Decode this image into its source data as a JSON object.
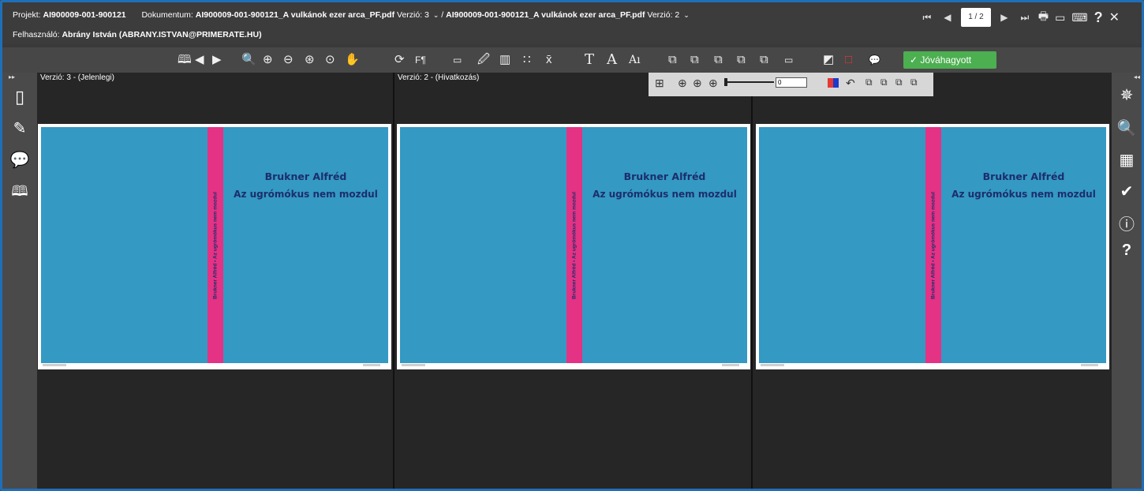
{
  "header": {
    "project_label": "Projekt:",
    "project_value": "AI900009-001-900121",
    "document_label": "Dokumentum:",
    "document_value": "AI900009-001-900121_A vulkánok ezer arca_PF.pdf",
    "version_label": "Verzió:",
    "version_value": "3",
    "slash": "/",
    "document_value2": "AI900009-001-900121_A vulkánok ezer arca_PF.pdf",
    "version_value2": "2",
    "caret": "⌄",
    "user_label": "Felhasználó:",
    "user_value": "Abrány István (ABRANY.ISTVAN@PRIMERATE.HU)"
  },
  "pager": {
    "page": "1 / 2",
    "first": "⏮",
    "prev": "◀",
    "next": "▶",
    "last": "⏭",
    "print": "🖶",
    "window": "▭",
    "keyboard": "⌨",
    "help": "?",
    "close": "✕"
  },
  "toolbar": {
    "book": "🕮",
    "prev": "◀",
    "next": "▶",
    "search": "🔍",
    "zoom_in": "⊕",
    "zoom_out": "⊖",
    "zoom_fit": "⊛",
    "zoom_page": "⊙",
    "hand": "✋",
    "rotate": "⟳",
    "fonts": "F¶",
    "ruler": "▭",
    "dropper": "🖉",
    "barcode": "▥",
    "dots": "∷",
    "separation": "x̄",
    "text_t": "T",
    "text_a": "A",
    "text_ai": "Aı",
    "ov1": "⧉",
    "ov2": "⧉",
    "ov3": "⧉",
    "ov4": "⧉",
    "ov5": "⧉",
    "ov6": "▭",
    "box1": "◩",
    "box2": "□",
    "comment": "💬",
    "approve_icon": "✓",
    "approve_label": "Jóváhagyott"
  },
  "panels": [
    {
      "title": "Verzió: 3 - (Jelenlegi)"
    },
    {
      "title": "Verzió: 2 - (Hivatkozás)"
    },
    {
      "title": ""
    }
  ],
  "cover": {
    "author": "Brukner Alfréd",
    "title": "Az ugrómókus nem mozdul",
    "spine": "Brukner Alfréd • Az ugrómókus nem mozdul"
  },
  "floater": {
    "grid": "⊞",
    "z1": "⊕",
    "z2": "⊕",
    "z3": "⊕",
    "slider_value": "0",
    "undo": "↶",
    "l1": "⧉",
    "l2": "⧉",
    "l3": "⧉",
    "l4": "⧉"
  },
  "leftbar": {
    "page_icon": "▯",
    "edit_icon": "✎",
    "chat_icon": "💬",
    "book_icon": "🕮",
    "collapse": "▸▸"
  },
  "rightbar": {
    "collapse": "◂◂",
    "compass": "✵",
    "search": "🔍",
    "checker": "▦",
    "check": "✔",
    "info": "ⓘ",
    "help": "?"
  }
}
